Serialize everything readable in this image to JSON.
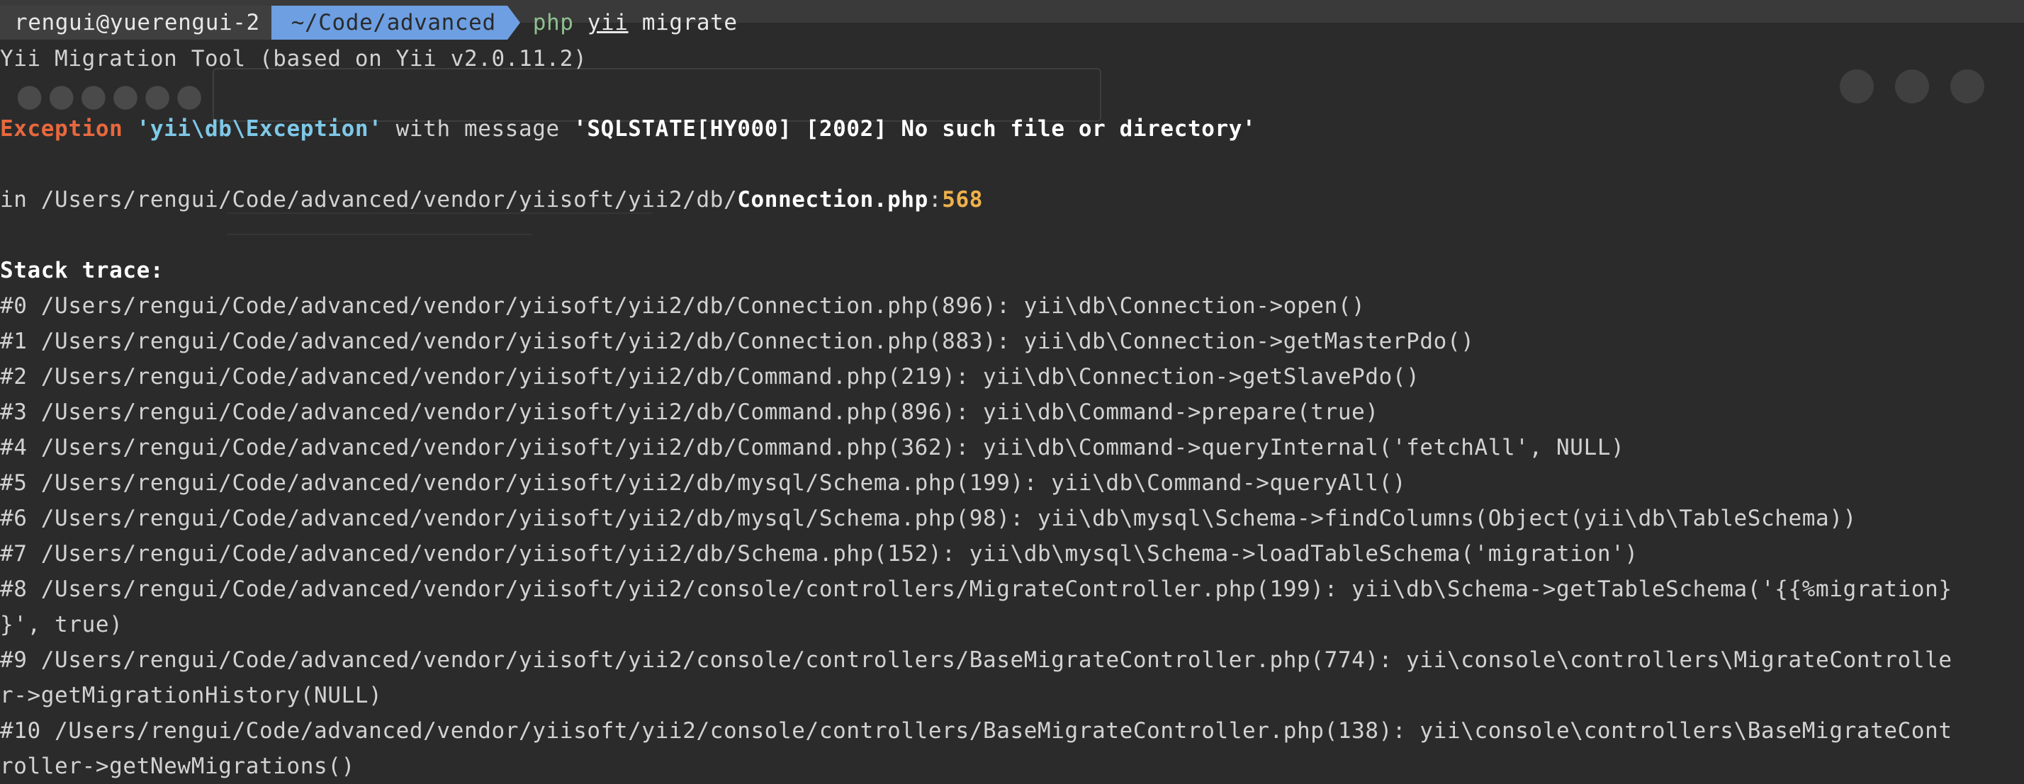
{
  "prompt": {
    "user_host": "rengui@yuerengui-2",
    "directory": "~/Code/advanced",
    "cmd_php": "php",
    "cmd_yii": "yii",
    "cmd_args": "migrate"
  },
  "output": {
    "tool_line": "Yii Migration Tool (based on Yii v2.0.11.2)",
    "exception_label": "Exception",
    "exception_class": "'yii\\db\\Exception'",
    "with_message": " with message ",
    "message": "'SQLSTATE[HY000] [2002] No such file or directory'",
    "in_prefix": "in /Users/rengui/Code/advanced/vendor/yiisoft/yii2/db/",
    "in_file": "Connection.php",
    "in_colon": ":",
    "in_line": "568",
    "stack_title": "Stack trace:",
    "trace": [
      "#0 /Users/rengui/Code/advanced/vendor/yiisoft/yii2/db/Connection.php(896): yii\\db\\Connection->open()",
      "#1 /Users/rengui/Code/advanced/vendor/yiisoft/yii2/db/Connection.php(883): yii\\db\\Connection->getMasterPdo()",
      "#2 /Users/rengui/Code/advanced/vendor/yiisoft/yii2/db/Command.php(219): yii\\db\\Connection->getSlavePdo()",
      "#3 /Users/rengui/Code/advanced/vendor/yiisoft/yii2/db/Command.php(896): yii\\db\\Command->prepare(true)",
      "#4 /Users/rengui/Code/advanced/vendor/yiisoft/yii2/db/Command.php(362): yii\\db\\Command->queryInternal('fetchAll', NULL)",
      "#5 /Users/rengui/Code/advanced/vendor/yiisoft/yii2/db/mysql/Schema.php(199): yii\\db\\Command->queryAll()",
      "#6 /Users/rengui/Code/advanced/vendor/yiisoft/yii2/db/mysql/Schema.php(98): yii\\db\\mysql\\Schema->findColumns(Object(yii\\db\\TableSchema))",
      "#7 /Users/rengui/Code/advanced/vendor/yiisoft/yii2/db/Schema.php(152): yii\\db\\mysql\\Schema->loadTableSchema('migration')",
      "#8 /Users/rengui/Code/advanced/vendor/yiisoft/yii2/console/controllers/MigrateController.php(199): yii\\db\\Schema->getTableSchema('{{%migration}",
      "}', true)",
      "#9 /Users/rengui/Code/advanced/vendor/yiisoft/yii2/console/controllers/BaseMigrateController.php(774): yii\\console\\controllers\\MigrateControlle",
      "r->getMigrationHistory(NULL)",
      "#10 /Users/rengui/Code/advanced/vendor/yiisoft/yii2/console/controllers/BaseMigrateController.php(138): yii\\console\\controllers\\BaseMigrateCont",
      "roller->getNewMigrations()"
    ]
  },
  "colors": {
    "background": "#2b2b2b",
    "exception": "#e8683e",
    "class": "#7ec8e8",
    "line_number": "#f0b24a",
    "prompt_dir_bg": "#6d9fe2",
    "prompt_user_bg": "#3f3f3f"
  }
}
